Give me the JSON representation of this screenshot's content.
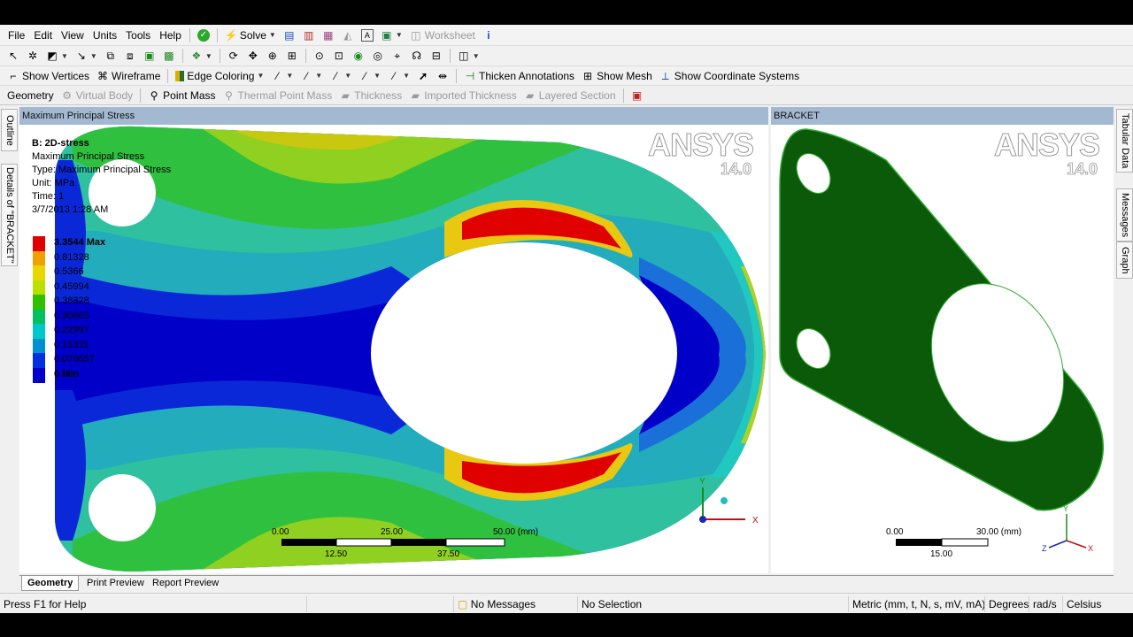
{
  "menu": [
    "File",
    "Edit",
    "View",
    "Units",
    "Tools",
    "Help"
  ],
  "toolbar1": {
    "solve_label": "Solve",
    "worksheet_label": "Worksheet"
  },
  "toolbar3": {
    "show_vertices": "Show Vertices",
    "wireframe": "Wireframe",
    "edge_coloring": "Edge Coloring",
    "thicken_annotations": "Thicken Annotations",
    "show_mesh": "Show Mesh",
    "show_coordinate_systems": "Show Coordinate Systems"
  },
  "toolbar4": {
    "geometry": "Geometry",
    "virtual_body": "Virtual Body",
    "point_mass": "Point Mass",
    "thermal_point_mass": "Thermal Point Mass",
    "thickness": "Thickness",
    "imported_thickness": "Imported Thickness",
    "layered_section": "Layered Section"
  },
  "left_tabs": [
    "Outline",
    "Details of \"BRACKET\""
  ],
  "right_tabs": [
    "Tabular Data",
    "Messages",
    "Graph"
  ],
  "main_view": {
    "header": "Maximum Principal Stress",
    "info": {
      "title": "B: 2D-stress",
      "line1": "Maximum Principal Stress",
      "line2": "Type: Maximum Principal Stress",
      "line3": "Unit: MPa",
      "line4": "Time: 1",
      "line5": "3/7/2013 1:28 AM"
    },
    "legend": [
      {
        "label": "3.3544 Max",
        "color": "#e00000"
      },
      {
        "label": "0.81328",
        "color": "#f0a000"
      },
      {
        "label": "0.5366",
        "color": "#e8d800"
      },
      {
        "label": "0.45994",
        "color": "#b8e000"
      },
      {
        "label": "0.38328",
        "color": "#30c000"
      },
      {
        "label": "0.30663",
        "color": "#00c060"
      },
      {
        "label": "0.22997",
        "color": "#00c8c8"
      },
      {
        "label": "0.15331",
        "color": "#0090d0"
      },
      {
        "label": "0.076657",
        "color": "#0030e0"
      },
      {
        "label": "0 Min",
        "color": "#0000c8"
      }
    ],
    "scale": {
      "t0": "0.00",
      "t1": "25.00",
      "t2": "50.00 (mm)",
      "b1": "12.50",
      "b2": "37.50"
    },
    "logo": "ANSYS",
    "version": "14.0"
  },
  "side_view": {
    "header": "BRACKET",
    "logo": "ANSYS",
    "version": "14.0",
    "scale": {
      "t0": "0.00",
      "t1": "30.00 (mm)",
      "b1": "15.00"
    },
    "fill_color": "#0a5a0a"
  },
  "bottom_tabs": [
    "Geometry",
    "Print Preview",
    "Report Preview"
  ],
  "status": {
    "help": "Press F1 for Help",
    "messages": "No Messages",
    "selection": "No Selection",
    "units": "Metric (mm, t, N, s, mV, mA)",
    "angle": "Degrees",
    "rotation": "rad/s",
    "temp": "Celsius"
  }
}
